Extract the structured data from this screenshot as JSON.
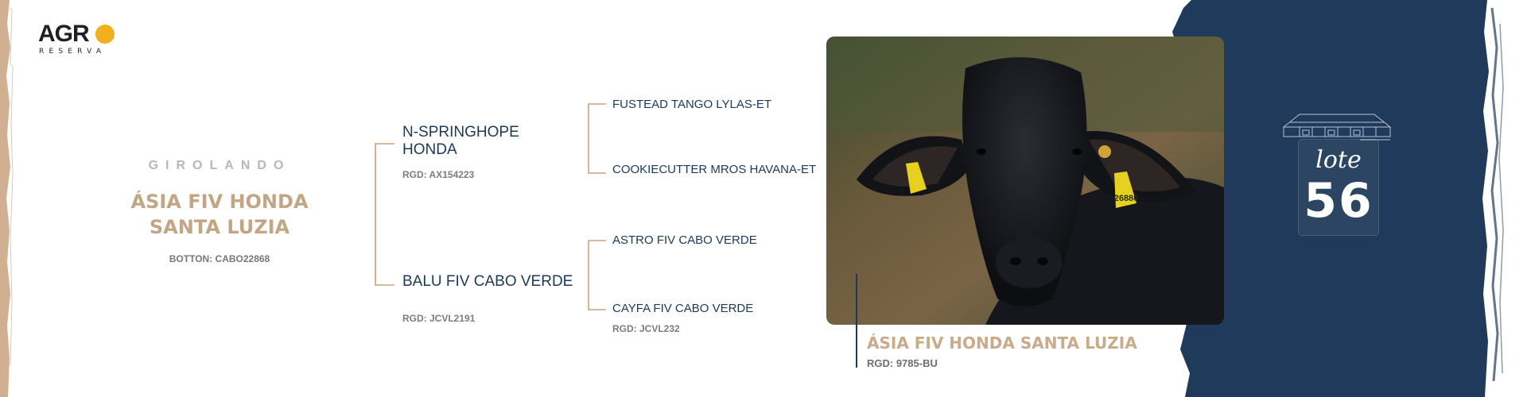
{
  "brand": {
    "logo_main": "AGR",
    "logo_sub": "RESERVA",
    "accent": "#f2b01e"
  },
  "animal": {
    "breed": "GIROLANDO",
    "name": "ÁSIA FIV HONDA SANTA LUZIA",
    "botton": "BOTTON: CABO22868"
  },
  "pedigree": {
    "sire": {
      "name": "N-SPRINGHOPE HONDA",
      "rgd": "RGD: AX154223",
      "sire": "FUSTEAD TANGO LYLAS-ET",
      "dam": "COOKIECUTTER MROS HAVANA-ET"
    },
    "dam": {
      "name": "BALU FIV CABO VERDE",
      "rgd": "RGD: JCVL2191",
      "sire": "ASTRO FIV CABO VERDE",
      "dam": "CAYFA FIV CABO VERDE",
      "dam_rgd": "RGD: JCVL232"
    }
  },
  "photo": {
    "ear_tag": "26886"
  },
  "caption": {
    "name": "ÁSIA FIV HONDA SANTA LUZIA",
    "rgd": "RGD: 9785-BU"
  },
  "lot": {
    "word": "lote",
    "number": "56"
  },
  "colors": {
    "navy": "#1f3a5a",
    "gold": "#c2a584",
    "line": "#c9a27e"
  }
}
